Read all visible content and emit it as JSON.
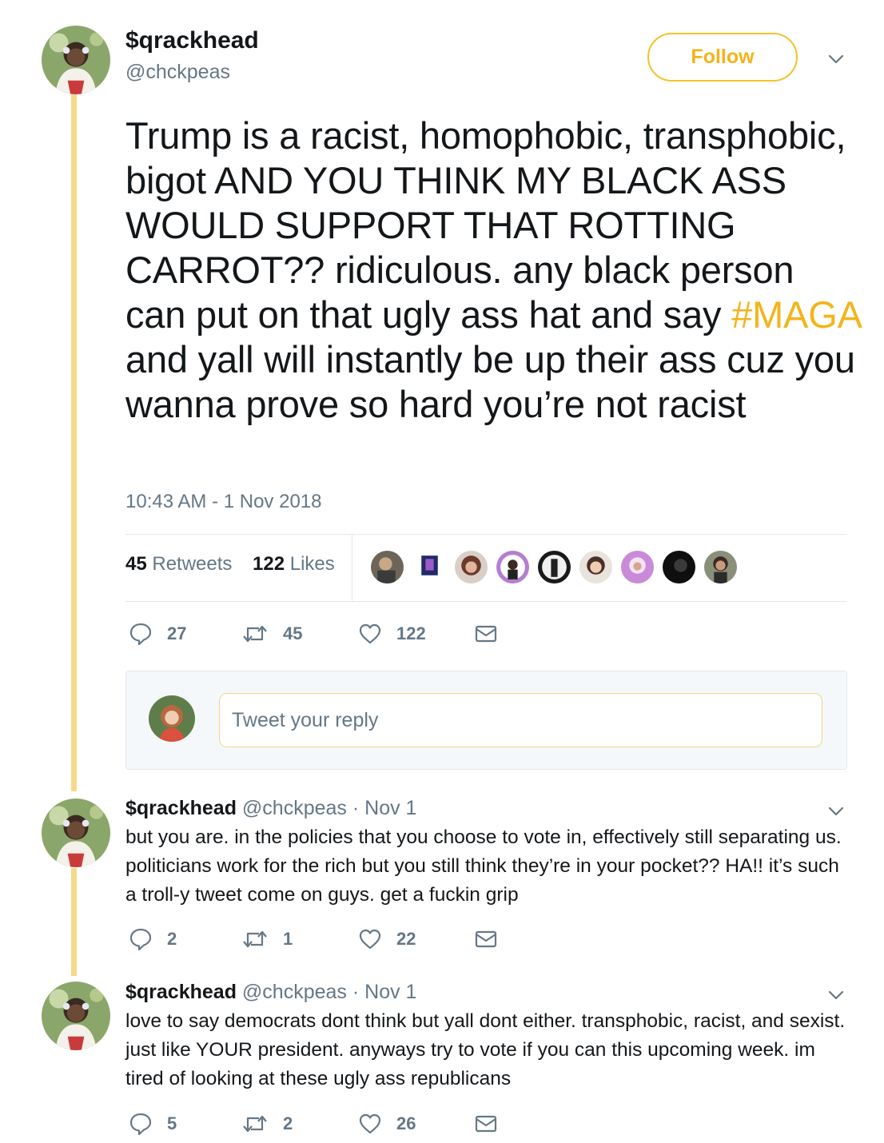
{
  "colors": {
    "accent": "#f3b41b",
    "thread_line": "#f5d98a",
    "muted": "#657786",
    "text": "#14171a",
    "border": "#e1e8ed"
  },
  "main_tweet": {
    "author_name": "$qrackhead",
    "author_handle": "@chckpeas",
    "follow_label": "Follow",
    "text_before": "Trump is a racist, homophobic, transphobic, bigot AND YOU THINK MY BLACK ASS WOULD SUPPORT THAT ROTTING CARROT?? ridiculous. any black person can put on that ugly ass hat and say ",
    "hashtag": "#MAGA",
    "text_after": " and yall will instantly be up their ass cuz you wanna prove so hard you’re not racist",
    "timestamp": "10:43 AM - 1 Nov 2018",
    "retweets_count": "45",
    "retweets_label": "Retweets",
    "likes_count": "122",
    "likes_label": "Likes",
    "liker_avatar_count": 9,
    "actions": {
      "replies": "27",
      "retweets": "45",
      "likes": "122"
    }
  },
  "reply_composer": {
    "placeholder": "Tweet your reply"
  },
  "replies": [
    {
      "author_name": "$qrackhead",
      "author_handle": "@chckpeas",
      "date": "· Nov 1",
      "text": "but you are. in the policies that you choose to vote in, effectively still separating us. politicians work for the rich but you still think they’re in your pocket?? HA!! it’s such a troll-y tweet come on guys. get a fuckin grip",
      "actions": {
        "replies": "2",
        "retweets": "1",
        "likes": "22"
      }
    },
    {
      "author_name": "$qrackhead",
      "author_handle": "@chckpeas",
      "date": "· Nov 1",
      "text": "love to say democrats dont think but yall dont either. transphobic, racist, and sexist. just like YOUR president. anyways try to vote if you can this upcoming week. im tired of looking at these ugly ass republicans",
      "actions": {
        "replies": "5",
        "retweets": "2",
        "likes": "26"
      }
    }
  ],
  "icons": {
    "reply": "reply-icon",
    "retweet": "retweet-icon",
    "like": "heart-icon",
    "dm": "envelope-icon",
    "caret": "chevron-down-icon"
  }
}
